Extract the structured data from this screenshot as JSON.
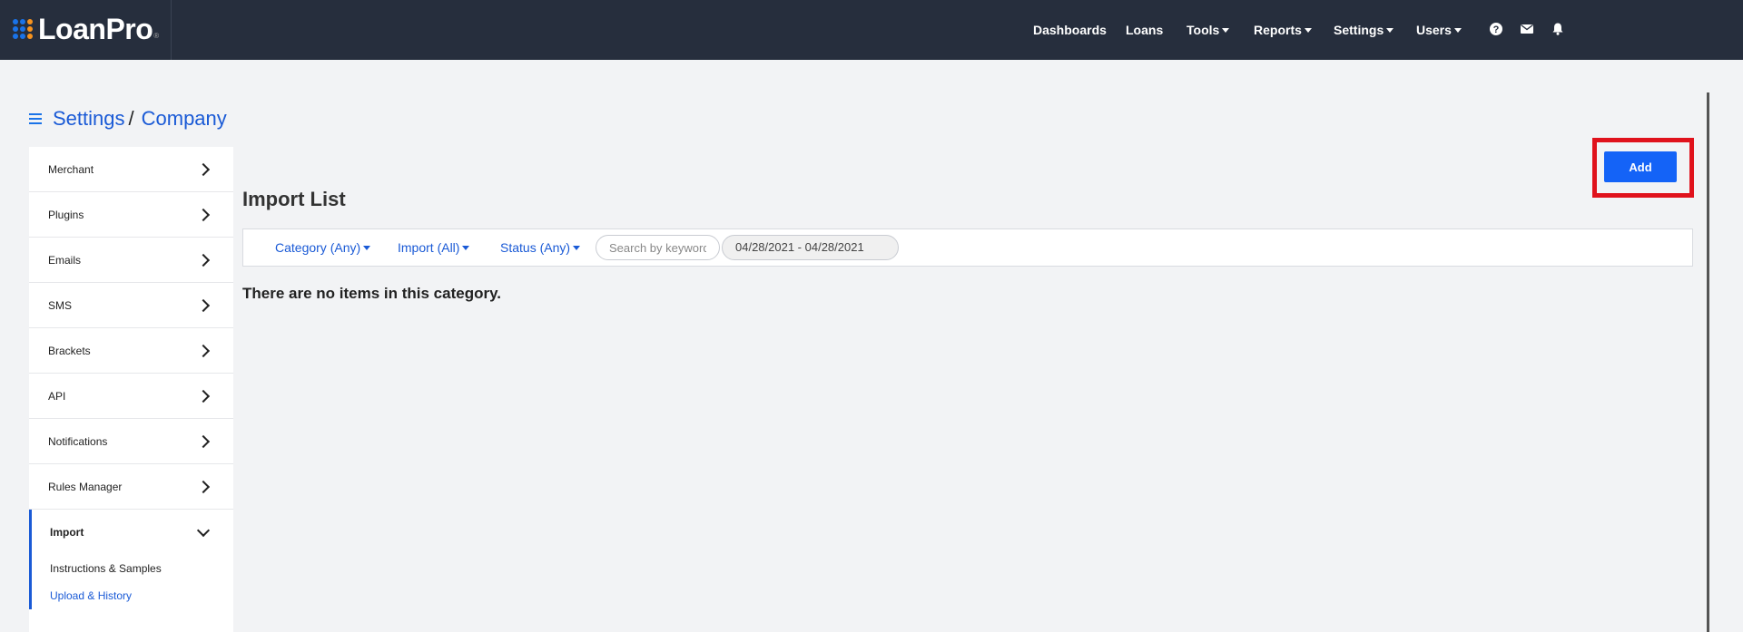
{
  "brand": {
    "name": "LoanPro",
    "reg": "®",
    "dot_colors": [
      "#1a73e8",
      "#1a73e8",
      "#f7931e",
      "#1a73e8",
      "#1a73e8",
      "#f7931e",
      "#1a73e8",
      "#1a73e8",
      "#f7931e"
    ]
  },
  "nav": {
    "dashboards": "Dashboards",
    "loans": "Loans",
    "tools": "Tools",
    "reports": "Reports",
    "settings": "Settings",
    "users": "Users",
    "icons": [
      "help-icon",
      "mail-icon",
      "bell-icon"
    ]
  },
  "breadcrumb": {
    "root": "Settings",
    "separator": "/",
    "current": "Company"
  },
  "sidebar": {
    "items": [
      {
        "label": "Merchant"
      },
      {
        "label": "Plugins"
      },
      {
        "label": "Emails"
      },
      {
        "label": "SMS"
      },
      {
        "label": "Brackets"
      },
      {
        "label": "API"
      },
      {
        "label": "Notifications"
      },
      {
        "label": "Rules Manager"
      }
    ],
    "import": {
      "label": "Import",
      "sub_items": [
        {
          "label": "Instructions & Samples"
        },
        {
          "label": "Upload & History"
        }
      ]
    }
  },
  "main": {
    "title": "Import List",
    "add_label": "Add",
    "filters": {
      "category": "Category (Any)",
      "import": "Import (All)",
      "status": "Status (Any)",
      "search_placeholder": "Search by keyword",
      "date_range": "04/28/2021 - 04/28/2021"
    },
    "empty_message": "There are no items in this category."
  },
  "colors": {
    "topbar": "#262e3d",
    "accent": "#1a5ad6",
    "button": "#1463f7",
    "highlight": "#e0121c"
  }
}
